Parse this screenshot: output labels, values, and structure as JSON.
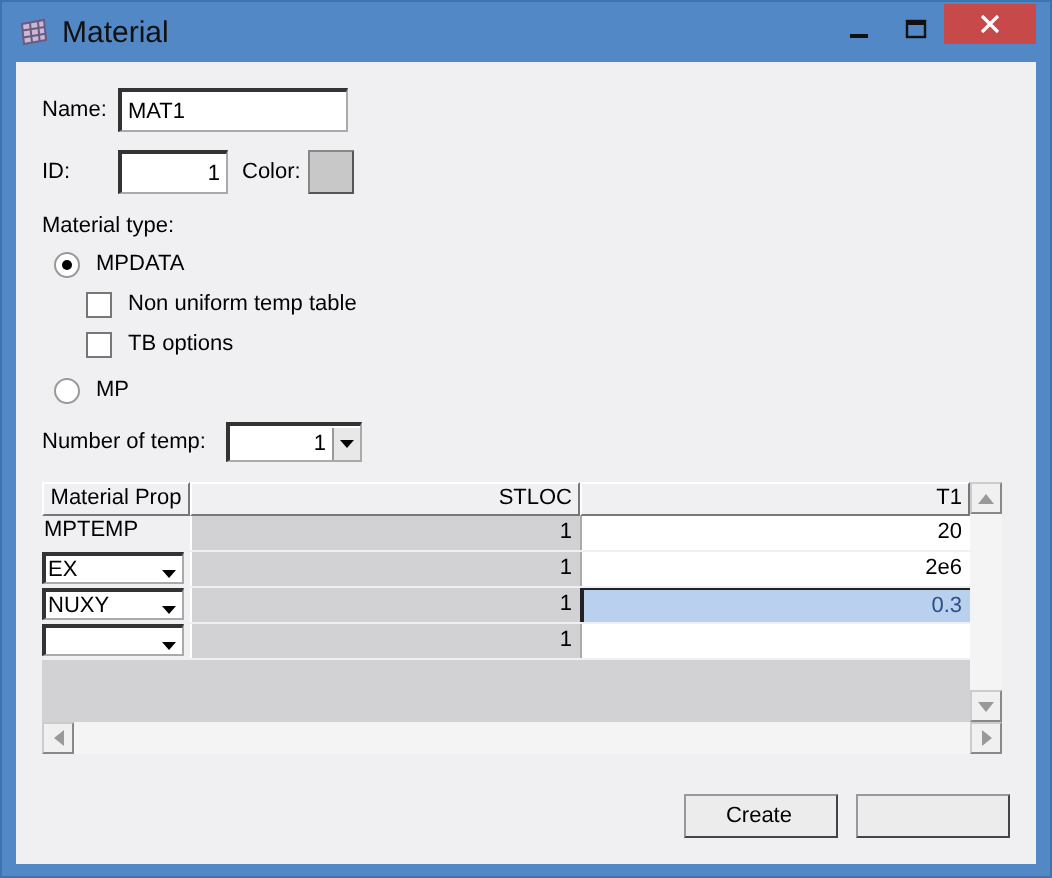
{
  "window": {
    "title": "Material"
  },
  "name": {
    "label": "Name:",
    "value": "MAT1"
  },
  "id": {
    "label": "ID:",
    "value": "1"
  },
  "color": {
    "label": "Color:"
  },
  "material_type": {
    "label": "Material type:",
    "options": [
      {
        "label": "MPDATA",
        "selected": true,
        "children": [
          {
            "label": "Non uniform temp table",
            "checked": false
          },
          {
            "label": "TB options",
            "checked": false
          }
        ]
      },
      {
        "label": "MP",
        "selected": false
      }
    ]
  },
  "number_of_temp": {
    "label": "Number of temp:",
    "value": "1"
  },
  "table": {
    "columns": [
      "Material Prop",
      "STLOC",
      "T1"
    ],
    "rows": [
      {
        "kind": "label",
        "prop": "MPTEMP",
        "stloc": "1",
        "t1": "20",
        "selected": false
      },
      {
        "kind": "dropdown",
        "prop": "EX",
        "stloc": "1",
        "t1": "2e6",
        "selected": false
      },
      {
        "kind": "dropdown",
        "prop": "NUXY",
        "stloc": "1",
        "t1": "0.3",
        "selected": true
      },
      {
        "kind": "dropdown",
        "stloc": "1",
        "selected": false
      }
    ]
  },
  "buttons": [
    {
      "kind": "create",
      "label": "Create"
    },
    {
      "kind": "blank"
    }
  ]
}
